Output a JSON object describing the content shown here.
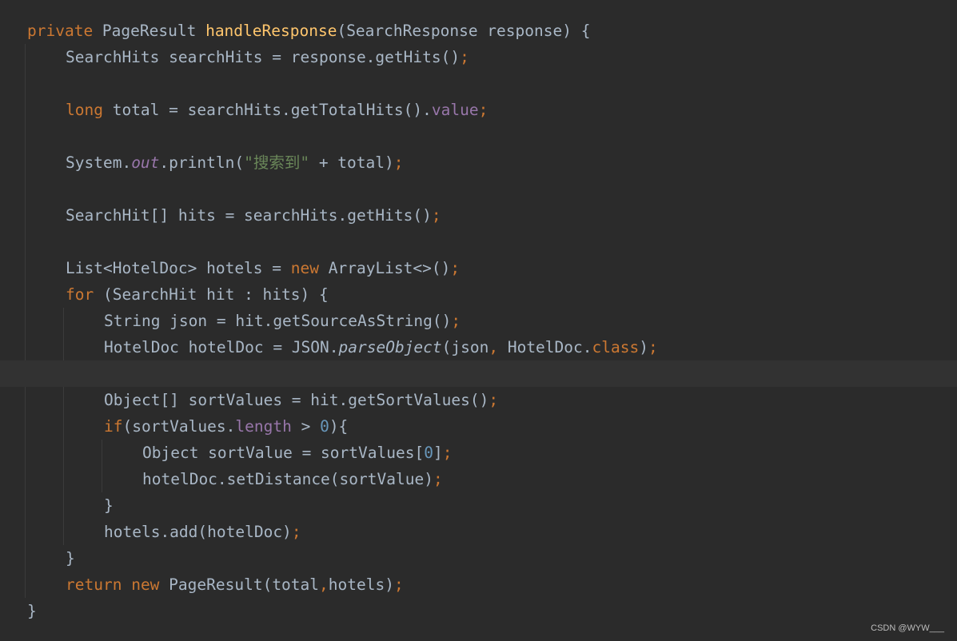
{
  "editor": {
    "lines": [
      {
        "indent": 0,
        "tokens": [
          {
            "t": "private",
            "c": "kw"
          },
          {
            "t": " PageResult "
          },
          {
            "t": "handleResponse",
            "c": "fn"
          },
          {
            "t": "(SearchResponse response) {"
          }
        ]
      },
      {
        "indent": 1,
        "tokens": [
          {
            "t": "SearchHits searchHits = response.getHits()"
          },
          {
            "t": ";",
            "c": "punct"
          }
        ]
      },
      {
        "indent": 0,
        "tokens": []
      },
      {
        "indent": 1,
        "tokens": [
          {
            "t": "long",
            "c": "kw"
          },
          {
            "t": " total = searchHits.getTotalHits()."
          },
          {
            "t": "value",
            "c": "field"
          },
          {
            "t": ";",
            "c": "punct"
          }
        ]
      },
      {
        "indent": 0,
        "tokens": []
      },
      {
        "indent": 1,
        "tokens": [
          {
            "t": "System."
          },
          {
            "t": "out",
            "c": "static"
          },
          {
            "t": ".println("
          },
          {
            "t": "\"搜索到\"",
            "c": "str"
          },
          {
            "t": " + total)"
          },
          {
            "t": ";",
            "c": "punct"
          }
        ]
      },
      {
        "indent": 0,
        "tokens": []
      },
      {
        "indent": 1,
        "tokens": [
          {
            "t": "SearchHit[] hits = searchHits.getHits()"
          },
          {
            "t": ";",
            "c": "punct"
          }
        ]
      },
      {
        "indent": 0,
        "tokens": []
      },
      {
        "indent": 1,
        "tokens": [
          {
            "t": "List<HotelDoc> hotels = "
          },
          {
            "t": "new",
            "c": "kw"
          },
          {
            "t": " ArrayList<>()"
          },
          {
            "t": ";",
            "c": "punct"
          }
        ]
      },
      {
        "indent": 1,
        "tokens": [
          {
            "t": "for",
            "c": "kw"
          },
          {
            "t": " (SearchHit hit : hits) {"
          }
        ]
      },
      {
        "indent": 2,
        "tokens": [
          {
            "t": "String json = hit.getSourceAsString()"
          },
          {
            "t": ";",
            "c": "punct"
          }
        ]
      },
      {
        "indent": 2,
        "tokens": [
          {
            "t": "HotelDoc hotelDoc = JSON."
          },
          {
            "t": "parseObject",
            "c": "italic"
          },
          {
            "t": "(json"
          },
          {
            "t": ",",
            "c": "punct"
          },
          {
            "t": " HotelDoc."
          },
          {
            "t": "class",
            "c": "kw"
          },
          {
            "t": ")"
          },
          {
            "t": ";",
            "c": "punct"
          }
        ]
      },
      {
        "indent": 0,
        "tokens": [],
        "current": true
      },
      {
        "indent": 2,
        "tokens": [
          {
            "t": "Object[] sortValues = hit.getSortValues()"
          },
          {
            "t": ";",
            "c": "punct"
          }
        ]
      },
      {
        "indent": 2,
        "tokens": [
          {
            "t": "if",
            "c": "kw"
          },
          {
            "t": "(sortValues."
          },
          {
            "t": "length",
            "c": "field"
          },
          {
            "t": " > "
          },
          {
            "t": "0",
            "c": "num"
          },
          {
            "t": "){"
          }
        ]
      },
      {
        "indent": 3,
        "tokens": [
          {
            "t": "Object sortValue = sortValues["
          },
          {
            "t": "0",
            "c": "num"
          },
          {
            "t": "]"
          },
          {
            "t": ";",
            "c": "punct"
          }
        ]
      },
      {
        "indent": 3,
        "tokens": [
          {
            "t": "hotelDoc.setDistance(sortValue)"
          },
          {
            "t": ";",
            "c": "punct"
          }
        ]
      },
      {
        "indent": 2,
        "tokens": [
          {
            "t": "}"
          }
        ]
      },
      {
        "indent": 2,
        "tokens": [
          {
            "t": "hotels.add(hotelDoc)"
          },
          {
            "t": ";",
            "c": "punct"
          }
        ]
      },
      {
        "indent": 1,
        "tokens": [
          {
            "t": "}"
          }
        ]
      },
      {
        "indent": 1,
        "tokens": [
          {
            "t": "return",
            "c": "kw"
          },
          {
            "t": " "
          },
          {
            "t": "new",
            "c": "kw"
          },
          {
            "t": " PageResult(total"
          },
          {
            "t": ",",
            "c": "punct"
          },
          {
            "t": "hotels)"
          },
          {
            "t": ";",
            "c": "punct"
          }
        ]
      },
      {
        "indent": 0,
        "tokens": [
          {
            "t": "}"
          }
        ]
      }
    ]
  },
  "watermark": "CSDN @WYW___"
}
